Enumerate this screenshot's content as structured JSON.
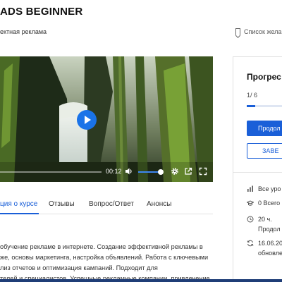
{
  "header": {
    "title": "ADS BEGINNER",
    "category": "ектная реклама",
    "wishlist_label": "Список жела"
  },
  "player": {
    "time": "00:12",
    "volume_level": 0.9,
    "icons": [
      "play-icon",
      "volume-icon",
      "gear-icon",
      "share-icon",
      "fullscreen-icon"
    ]
  },
  "tabs": [
    {
      "label": "ция о курсе",
      "active": true
    },
    {
      "label": "Отзывы",
      "active": false
    },
    {
      "label": "Вопрос/Ответ",
      "active": false
    },
    {
      "label": "Анонсы",
      "active": false
    }
  ],
  "description": {
    "lines": [
      "обучение рекламе в интернете. Создание эффективной рекламы в",
      "же, основы маркетинга, настройка объявлений. Работа с ключевыми",
      "лиз отчетов и оптимизация кампаний. Подходит для",
      "телей и специалистов. Успешные рекламные компании, привлечение"
    ]
  },
  "progress": {
    "title": "Прогрес",
    "count": "1/ 6",
    "fraction": 0.167,
    "continue_label": "Продол",
    "finish_label": "ЗАВЕ"
  },
  "info": [
    {
      "icon": "levels-icon",
      "lines": [
        "Все уро"
      ]
    },
    {
      "icon": "graduation-cap-icon",
      "lines": [
        "0 Всего"
      ]
    },
    {
      "icon": "clock-icon",
      "lines": [
        "20 ч.",
        "Продол"
      ]
    },
    {
      "icon": "refresh-icon",
      "lines": [
        "16.06.20",
        "обновле"
      ]
    }
  ],
  "colors": {
    "accent": "#1a5fd8",
    "play_button": "#1a73e8",
    "bottom_bar": "#1f3d77"
  }
}
